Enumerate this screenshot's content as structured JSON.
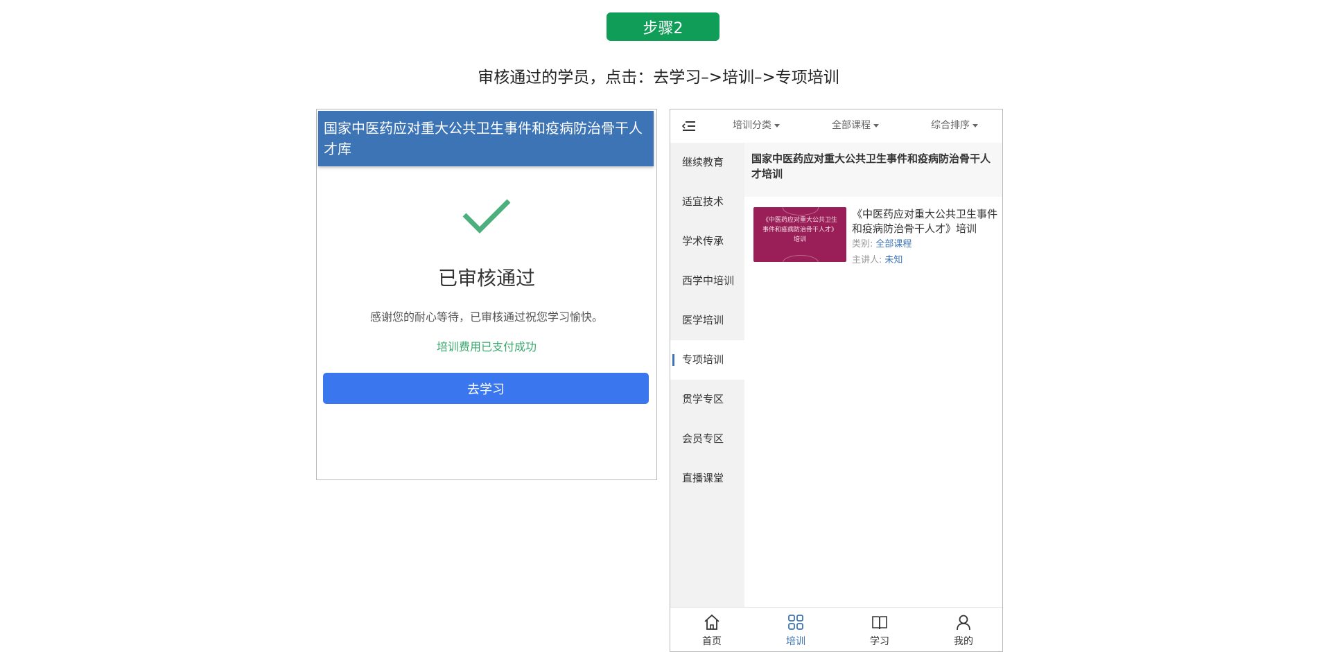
{
  "step": {
    "label": "步骤2"
  },
  "instruction": "审核通过的学员，点击：去学习–>培训–>专项培训",
  "left": {
    "header_title": "国家中医药应对重大公共卫生事件和疫病防治骨干人才库",
    "approved_title": "已审核通过",
    "thanks_text": "感谢您的耐心等待，已审核通过祝您学习愉快。",
    "paid_text": "培训费用已支付成功",
    "study_button": "去学习"
  },
  "right": {
    "filters": [
      "培训分类",
      "全部课程",
      "综合排序"
    ],
    "sidebar_items": [
      "继续教育",
      "适宜技术",
      "学术传承",
      "西学中培训",
      "医学培训",
      "专项培训",
      "贯学专区",
      "会员专区",
      "直播课堂"
    ],
    "active_sidebar": "专项培训",
    "section_title": "国家中医药应对重大公共卫生事件和疫病防治骨干人才培训",
    "course": {
      "cover_text": "《中医药应对重大公共卫生事件和疫病防治骨干人才》培训",
      "title": "《中医药应对重大公共卫生事件和疫病防治骨干人才》培训",
      "category_label": "类别:",
      "category_value": "全部课程",
      "speaker_label": "主讲人:",
      "speaker_value": "未知"
    },
    "bottom_nav": [
      "首页",
      "培训",
      "学习",
      "我的"
    ],
    "active_nav": "培训"
  },
  "colors": {
    "step_badge": "#0f9d58",
    "header_blue": "#3d74b5",
    "button_blue": "#3a77ee",
    "check_green": "#4caf7d",
    "paid_green": "#3aa86c",
    "cover": "#9a1f58"
  }
}
